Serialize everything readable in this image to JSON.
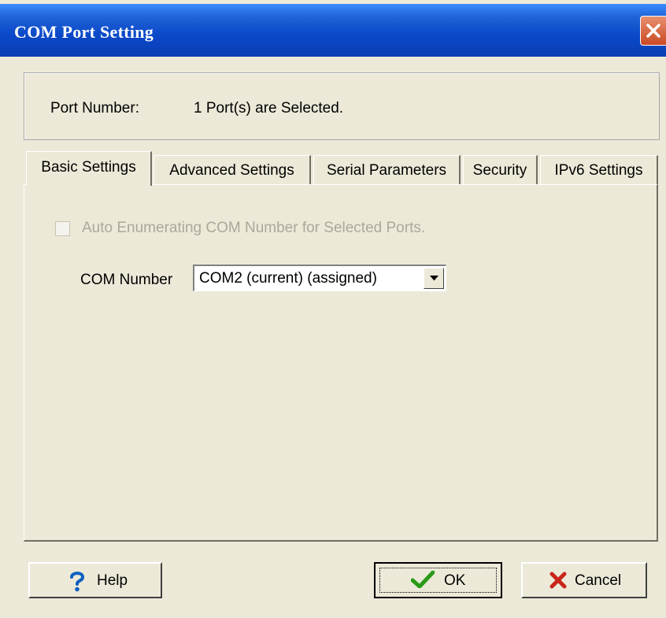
{
  "window": {
    "title": "COM Port Setting"
  },
  "info": {
    "port_label": "Port Number:",
    "port_value": "1 Port(s) are Selected."
  },
  "tabs": [
    {
      "label": "Basic Settings",
      "active": true
    },
    {
      "label": "Advanced Settings",
      "active": false
    },
    {
      "label": "Serial Parameters",
      "active": false
    },
    {
      "label": "Security",
      "active": false
    },
    {
      "label": "IPv6 Settings",
      "active": false
    }
  ],
  "basic": {
    "auto_enum_label": "Auto Enumerating COM Number for Selected Ports.",
    "auto_enum_checked": false,
    "auto_enum_enabled": false,
    "com_number_label": "COM Number",
    "com_number_value": "COM2 (current) (assigned)"
  },
  "buttons": {
    "help": {
      "label": "Help",
      "icon": "question-icon"
    },
    "ok": {
      "label": "OK",
      "icon": "checkmark-icon"
    },
    "cancel": {
      "label": "Cancel",
      "icon": "x-icon"
    }
  },
  "colors": {
    "titlebar": "#0a48c8",
    "dialog_bg": "#ece9d8",
    "close_red": "#d8542a",
    "disabled_text": "#aca899"
  }
}
